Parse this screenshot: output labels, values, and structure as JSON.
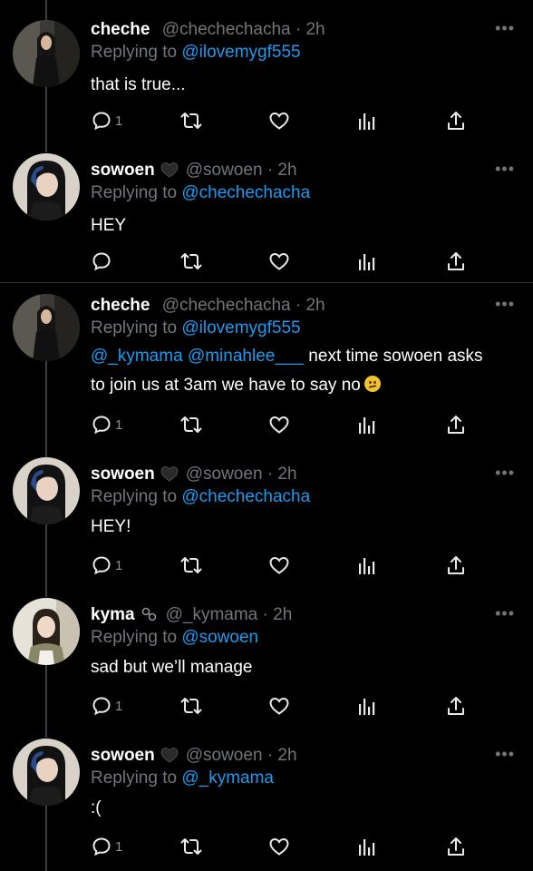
{
  "tweets": [
    {
      "name": "cheche",
      "handle": "@chechechacha",
      "time": "2h",
      "replying_prefix": "Replying to",
      "replying_to": "@ilovemygf555",
      "text": "that is true...",
      "reply_count": "1",
      "avatar": "cheche-avatar"
    },
    {
      "name": "sowoen",
      "badge": "black-heart",
      "handle": "@sowoen",
      "time": "2h",
      "replying_prefix": "Replying to",
      "replying_to": "@chechechacha",
      "text": "HEY",
      "reply_count": "",
      "avatar": "sowoen-avatar"
    },
    {
      "name": "cheche",
      "handle": "@chechechacha",
      "time": "2h",
      "replying_prefix": "Replying to",
      "replying_to": "@ilovemygf555",
      "mention1": "@_kymama",
      "mention2": "@minahlee___",
      "text_line1_rest": " next time sowoen asks",
      "text_line2": "to join us at 3am we have to say no",
      "emoji": "confused-face-emoji",
      "reply_count": "1",
      "avatar": "cheche-avatar"
    },
    {
      "name": "sowoen",
      "badge": "black-heart",
      "handle": "@sowoen",
      "time": "2h",
      "replying_prefix": "Replying to",
      "replying_to": "@chechechacha",
      "text": "HEY!",
      "reply_count": "1",
      "avatar": "sowoen-avatar"
    },
    {
      "name": "kyma",
      "badge": "link-rings",
      "handle": "@_kymama",
      "time": "2h",
      "replying_prefix": "Replying to",
      "replying_to": "@sowoen",
      "text": "sad but we’ll manage",
      "reply_count": "1",
      "avatar": "kyma-avatar"
    },
    {
      "name": "sowoen",
      "badge": "black-heart",
      "handle": "@sowoen",
      "time": "2h",
      "replying_prefix": "Replying to",
      "replying_to": "@_kymama",
      "text": ":(",
      "reply_count": "1",
      "avatar": "sowoen-avatar"
    }
  ],
  "separator_dot": "·",
  "more_glyph": "•••",
  "colors": {
    "background": "#000000",
    "text": "#ffffff",
    "muted": "#71767b",
    "mention": "#1d9bf0",
    "separator": "#2f3336"
  },
  "icons": [
    "reply-icon",
    "retweet-icon",
    "like-icon",
    "views-icon",
    "share-icon",
    "more-icon"
  ]
}
